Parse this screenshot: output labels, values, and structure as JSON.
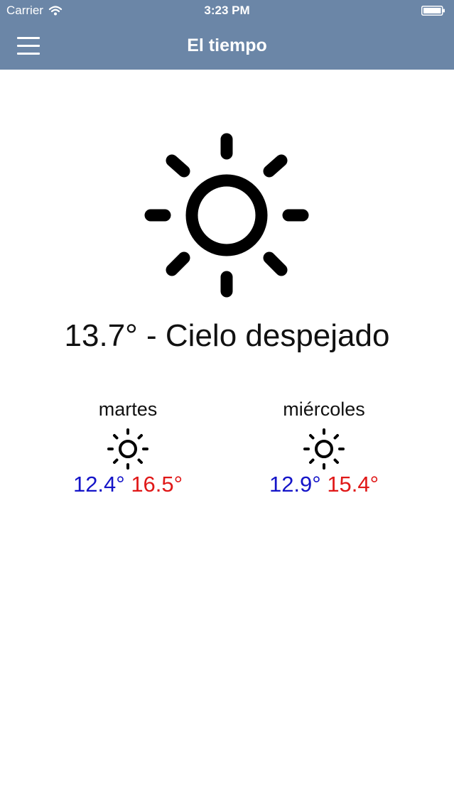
{
  "status_bar": {
    "carrier": "Carrier",
    "time": "3:23 PM"
  },
  "navbar": {
    "title": "El tiempo",
    "menu_icon": "hamburger-menu-icon",
    "background_color": "#6b86a7"
  },
  "current": {
    "icon": "sun-icon",
    "temperature": "13.7°",
    "separator": " - ",
    "condition": "Cielo despejado"
  },
  "forecast": [
    {
      "day": "martes",
      "icon": "sun-icon",
      "min": "12.4°",
      "max": "16.5°"
    },
    {
      "day": "miércoles",
      "icon": "sun-icon",
      "min": "12.9°",
      "max": "15.4°"
    }
  ],
  "colors": {
    "min_temp": "#1414c8",
    "max_temp": "#e01818"
  }
}
